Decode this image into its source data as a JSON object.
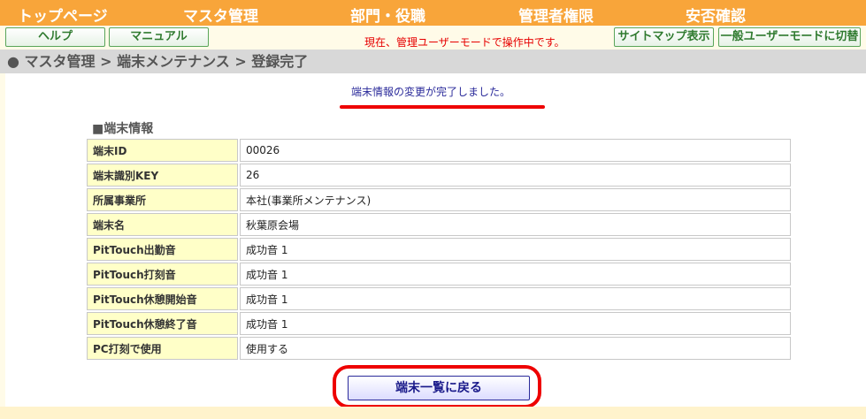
{
  "topnav": {
    "items": [
      "トップページ",
      "マスタ管理",
      "部門・役職",
      "管理者権限",
      "安否確認"
    ]
  },
  "buttons": {
    "help": "ヘルプ",
    "manual": "マニュアル",
    "sitemap": "サイトマップ表示",
    "switch_mode": "一般ユーザーモードに切替"
  },
  "mode_notice": "現在、管理ユーザーモードで操作中です。",
  "breadcrumb": "● マスタ管理 > 端末メンテナンス > 登録完了",
  "message": "端末情報の変更が完了しました。",
  "section_title": "■端末情報",
  "table": [
    {
      "label": "端末ID",
      "value": "00026"
    },
    {
      "label": "端末識別KEY",
      "value": "26"
    },
    {
      "label": "所属事業所",
      "value": "本社(事業所メンテナンス)"
    },
    {
      "label": "端末名",
      "value": "秋葉原会場"
    },
    {
      "label": "PitTouch出勤音",
      "value": "成功音 1"
    },
    {
      "label": "PitTouch打刻音",
      "value": "成功音 1"
    },
    {
      "label": "PitTouch休憩開始音",
      "value": "成功音 1"
    },
    {
      "label": "PitTouch休憩終了音",
      "value": "成功音 1"
    },
    {
      "label": "PC打刻で使用",
      "value": "使用する"
    }
  ],
  "back_button": "端末一覧に戻る",
  "colors": {
    "nav_bg": "#f8a53a",
    "highlight_red": "#ee0000",
    "label_bg": "#ffffc8"
  }
}
